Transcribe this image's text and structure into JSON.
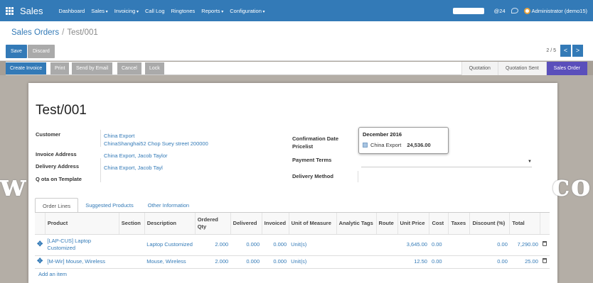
{
  "app": {
    "title": "Sales"
  },
  "nav": {
    "items": [
      {
        "label": "Dashboard",
        "caret": false
      },
      {
        "label": "Sales",
        "caret": true
      },
      {
        "label": "Invoicing",
        "caret": true
      },
      {
        "label": "Call Log",
        "caret": false
      },
      {
        "label": "Ringtones",
        "caret": false
      },
      {
        "label": "Reports",
        "caret": true
      },
      {
        "label": "Configuration",
        "caret": true
      }
    ],
    "notifications": "24",
    "user": "Administrator (demo15)"
  },
  "breadcrumb": {
    "parent": "Sales Orders",
    "current": "Test/001"
  },
  "toolbar": {
    "save_label": "Save",
    "discard_label": "Discard"
  },
  "pager": {
    "value": "2 / 5",
    "prev": "<",
    "next": ">"
  },
  "statusbar": {
    "buttons": [
      "Create Invoice",
      "Print",
      "Send by Email",
      "Cancel",
      "Lock"
    ],
    "stages": [
      "Quotation",
      "Quotation Sent",
      "Sales Order"
    ],
    "active_stage": "Sales Order"
  },
  "form": {
    "title": "Test/001",
    "customer_label": "Customer",
    "customer_name": "China Export",
    "customer_address": "ChinaShanghai52 Chop Suey street 200000",
    "invoice_address_label": "Invoice Address",
    "invoice_address": "China Export, Jacob Taylor",
    "delivery_address_label": "Delivery Address",
    "delivery_address": "China Export, Jacob Tayl",
    "quotation_template_label": "Q ota on Template",
    "confirmation_date_label": "Confirmation Date",
    "pricelist_label": "Pricelist",
    "payment_terms_label": "Payment Terms",
    "delivery_method_label": "Delivery Method",
    "popover": {
      "title": "December 2016",
      "partner": "China Export",
      "amount": "24,536.00"
    }
  },
  "watermark": {
    "left": "w",
    "right": "co"
  },
  "tabs": [
    "Order Lines",
    "Suggested Products",
    "Other Information"
  ],
  "order_lines": {
    "headers": [
      "Product",
      "Section",
      "Description",
      "Ordered Qty",
      "Delivered",
      "Invoiced",
      "Unit of Measure",
      "Analytic Tags",
      "Route",
      "Unit Price",
      "Cost",
      "Taxes",
      "Discount (%)",
      "Total"
    ],
    "rows": [
      {
        "product": "[LAP-CUS] Laptop Customized",
        "section": "",
        "description": "Laptop Customized",
        "ordered_qty": "2.000",
        "delivered": "0.000",
        "invoiced": "0.000",
        "uom": "Unit(s)",
        "analytic_tags": "",
        "route": "",
        "unit_price": "3,645.00",
        "cost": "0.00",
        "taxes": "",
        "discount": "0.00",
        "total": "7,290.00"
      },
      {
        "product": "[M-Wir] Mouse, Wireless",
        "section": "",
        "description": "Mouse, Wireless",
        "ordered_qty": "2.000",
        "delivered": "0.000",
        "invoiced": "0.000",
        "uom": "Unit(s)",
        "analytic_tags": "",
        "route": "",
        "unit_price": "12.50",
        "cost": "0.00",
        "taxes": "",
        "discount": "0.00",
        "total": "25.00"
      }
    ],
    "add_item_label": "Add an item"
  }
}
